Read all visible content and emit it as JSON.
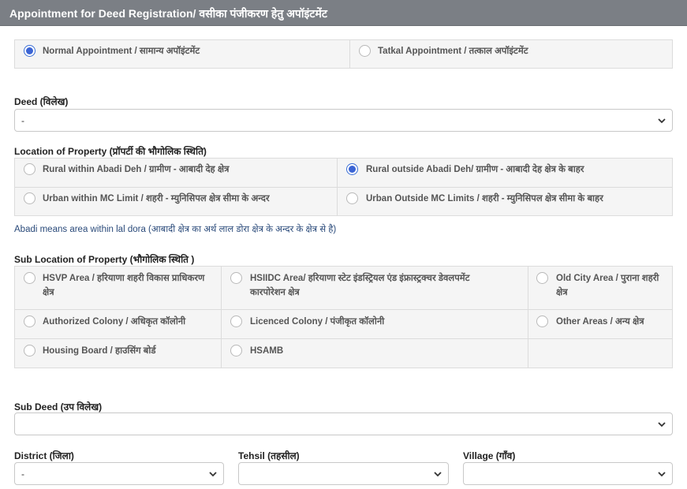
{
  "header": {
    "title": "Appointment for Deed Registration/ वसीका पंजीकरण हेतु अपॉइंटमेंट"
  },
  "appointment_type": {
    "options": [
      {
        "label": "Normal Appointment / सामान्य अपॉइंटमेंट",
        "selected": true
      },
      {
        "label": "Tatkal Appointment / तत्काल अपॉइंटमेंट",
        "selected": false
      }
    ]
  },
  "deed": {
    "label": "Deed (विलेख)",
    "value": "-"
  },
  "location": {
    "label": "Location of Property (प्रॉपर्टी की भौगोलिक स्थिति)",
    "options": [
      {
        "label": "Rural within Abadi Deh / ग्रामीण - आबादी देह क्षेत्र",
        "selected": false
      },
      {
        "label": "Rural outside Abadi Deh/ ग्रामीण - आबादी देह क्षेत्र के बाहर",
        "selected": true
      },
      {
        "label": "Urban within MC Limit / शहरी - म्युनिसिपल क्षेत्र सीमा के अन्दर",
        "selected": false
      },
      {
        "label": "Urban Outside MC Limits / शहरी - म्युनिसिपल क्षेत्र सीमा के बाहर",
        "selected": false
      }
    ],
    "note": "Abadi means area within lal dora (आबादी क्षेत्र का अर्थ लाल डोरा क्षेत्र के अन्दर के क्षेत्र से है)"
  },
  "sub_location": {
    "label": "Sub Location of Property (भौगोलिक स्थिति )",
    "options": [
      {
        "line1": "HSVP Area / हरियाणा शहरी विकास प्राधिकरण",
        "line2": "क्षेत्र"
      },
      {
        "line1": "HSIIDC Area/ हरियाणा स्टेट इंडस्ट्रियल एंड इंफ्रास्ट्रक्चर डेवलपमेंट",
        "line2": "कारपोरेशन क्षेत्र"
      },
      {
        "line1": "Old City Area / पुराना शहरी",
        "line2": "क्षेत्र"
      },
      {
        "line1": "Authorized Colony / अधिकृत कॉलोनी",
        "line2": ""
      },
      {
        "line1": "Licenced Colony / पंजीकृत कॉलोनी",
        "line2": ""
      },
      {
        "line1": "Other Areas / अन्य क्षेत्र",
        "line2": ""
      },
      {
        "line1": "Housing Board / हाउसिंग बोर्ड",
        "line2": ""
      },
      {
        "line1": "HSAMB",
        "line2": ""
      }
    ]
  },
  "sub_deed": {
    "label": "Sub Deed (उप विलेख)",
    "value": ""
  },
  "district": {
    "label": "District (जिला)",
    "value": "-"
  },
  "tehsil": {
    "label": "Tehsil (तहसील)",
    "value": ""
  },
  "village": {
    "label": "Village (गाँव)",
    "value": ""
  }
}
